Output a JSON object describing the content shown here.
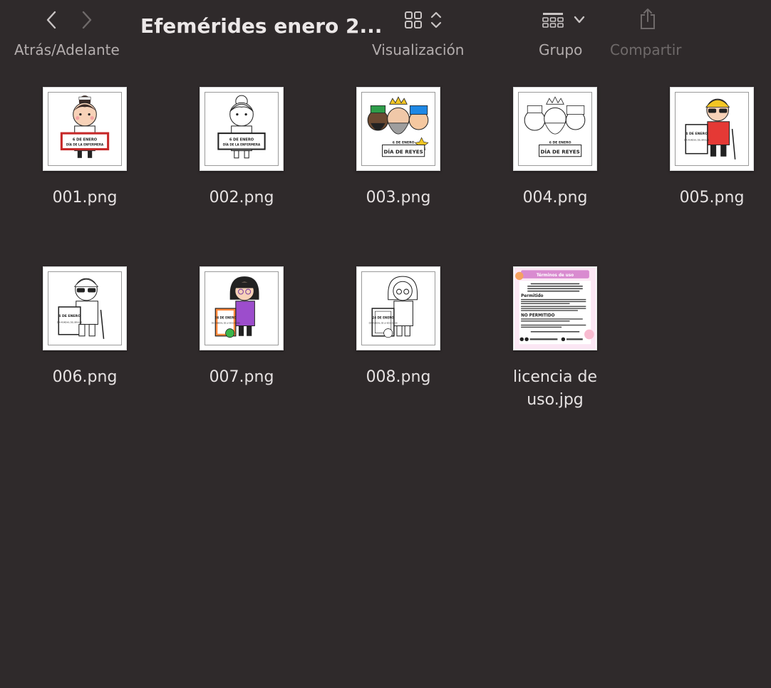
{
  "toolbar": {
    "title": "Efemérides enero 2...",
    "nav_label": "Atrás/Adelante",
    "view_label": "Visualización",
    "group_label": "Grupo",
    "share_label": "Compartir"
  },
  "files": [
    {
      "name": "001.png",
      "thumb": {
        "banner": "6 DE ENERO",
        "sub": "DÍA DE LA ENFERMERA",
        "style": "color"
      }
    },
    {
      "name": "002.png",
      "thumb": {
        "banner": "6 DE ENERO",
        "sub": "DÍA DE LA ENFERMERA",
        "style": "bw"
      }
    },
    {
      "name": "003.png",
      "thumb": {
        "banner": "6 DE ENERO",
        "sub": "DÍA DE REYES",
        "style": "color"
      }
    },
    {
      "name": "004.png",
      "thumb": {
        "banner": "6 DE ENERO",
        "sub": "DÍA DE REYES",
        "style": "bw"
      }
    },
    {
      "name": "005.png",
      "thumb": {
        "banner": "4 DE ENERO",
        "sub": "DÍA MUNDIAL DEL BRAILLE",
        "style": "color"
      }
    },
    {
      "name": "006.png",
      "thumb": {
        "banner": "4 DE ENERO",
        "sub": "DÍA MUNDIAL DEL BRAILLE",
        "style": "bw"
      }
    },
    {
      "name": "007.png",
      "thumb": {
        "banner": "24 DE ENERO",
        "sub": "DÍA MUNDIAL DE LA EDUCACIÓN",
        "style": "color"
      }
    },
    {
      "name": "008.png",
      "thumb": {
        "banner": "24 DE ENERO",
        "sub": "DÍA MUNDIAL DE LA EDUCACIÓN",
        "style": "bw"
      }
    },
    {
      "name_line1": "licencia de",
      "name_line2": "uso.jpg",
      "thumb": {
        "banner": "Términos de uso",
        "sub1": "Permitido",
        "sub2": "NO PERMITIDO",
        "style": "license"
      }
    }
  ],
  "colors": {
    "background": "#2f2a2b",
    "text": "#e6e2e2",
    "label": "#b3adad",
    "disabled": "#6f6a6a"
  }
}
